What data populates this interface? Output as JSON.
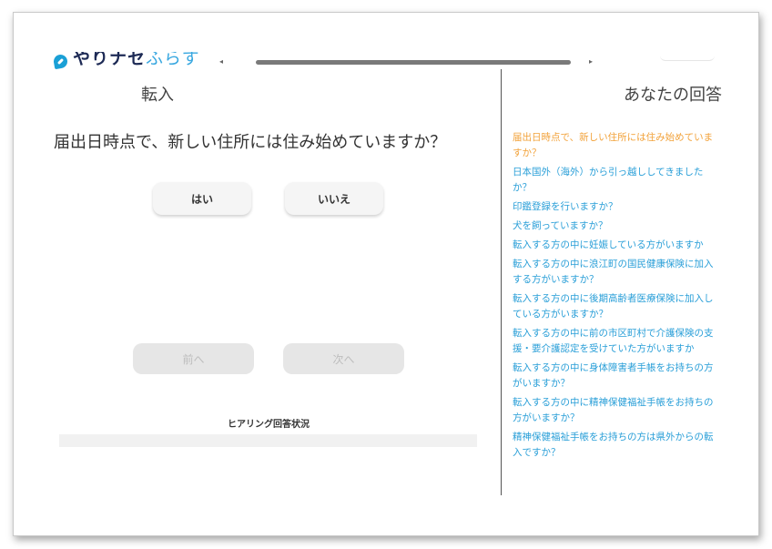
{
  "logo": {
    "text_main": "やりナセ",
    "text_accent": "ふらす"
  },
  "scrollbar": {
    "left_arrow": "◂",
    "right_arrow": "▸"
  },
  "left": {
    "title": "転入",
    "question": "届出日時点で、新しい住所には住み始めていますか？",
    "yes_label": "はい",
    "no_label": "いいえ",
    "prev_label": "前へ",
    "next_label": "次へ",
    "status_label": "ヒアリング回答状況"
  },
  "right": {
    "title": "あなたの回答",
    "answers": [
      "届出日時点で、新しい住所には住み始めていますか？",
      "日本国外（海外）から引っ越ししてきましたか？",
      "印鑑登録を行いますか？",
      "犬を飼っていますか？",
      "転入する方の中に妊娠している方がいますか",
      "転入する方の中に浪江町の国民健康保険に加入する方がいますか？",
      "転入する方の中に後期高齢者医療保険に加入している方がいますか？",
      "転入する方の中に前の市区町村で介護保険の支援・要介護認定を受けていた方がいますか",
      "転入する方の中に身体障害者手帳をお持ちの方がいますか？",
      "転入する方の中に精神保健福祉手帳をお持ちの方がいますか？",
      "精神保健福祉手帳をお持ちの方は県外からの転入ですか？"
    ],
    "current_index": 0
  },
  "colors": {
    "accent": "#2a9fd8",
    "current": "#f2a23a",
    "logo_dark": "#1d2a55"
  }
}
